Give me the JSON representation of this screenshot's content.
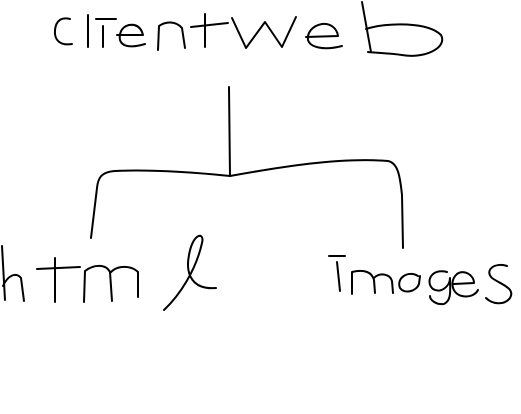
{
  "diagram": {
    "style": "hand-drawn",
    "root": {
      "label": "clientweb"
    },
    "children": [
      {
        "label": "html"
      },
      {
        "label": "images"
      }
    ]
  },
  "colors": {
    "background": "#ffffff",
    "ink": "#000000"
  }
}
